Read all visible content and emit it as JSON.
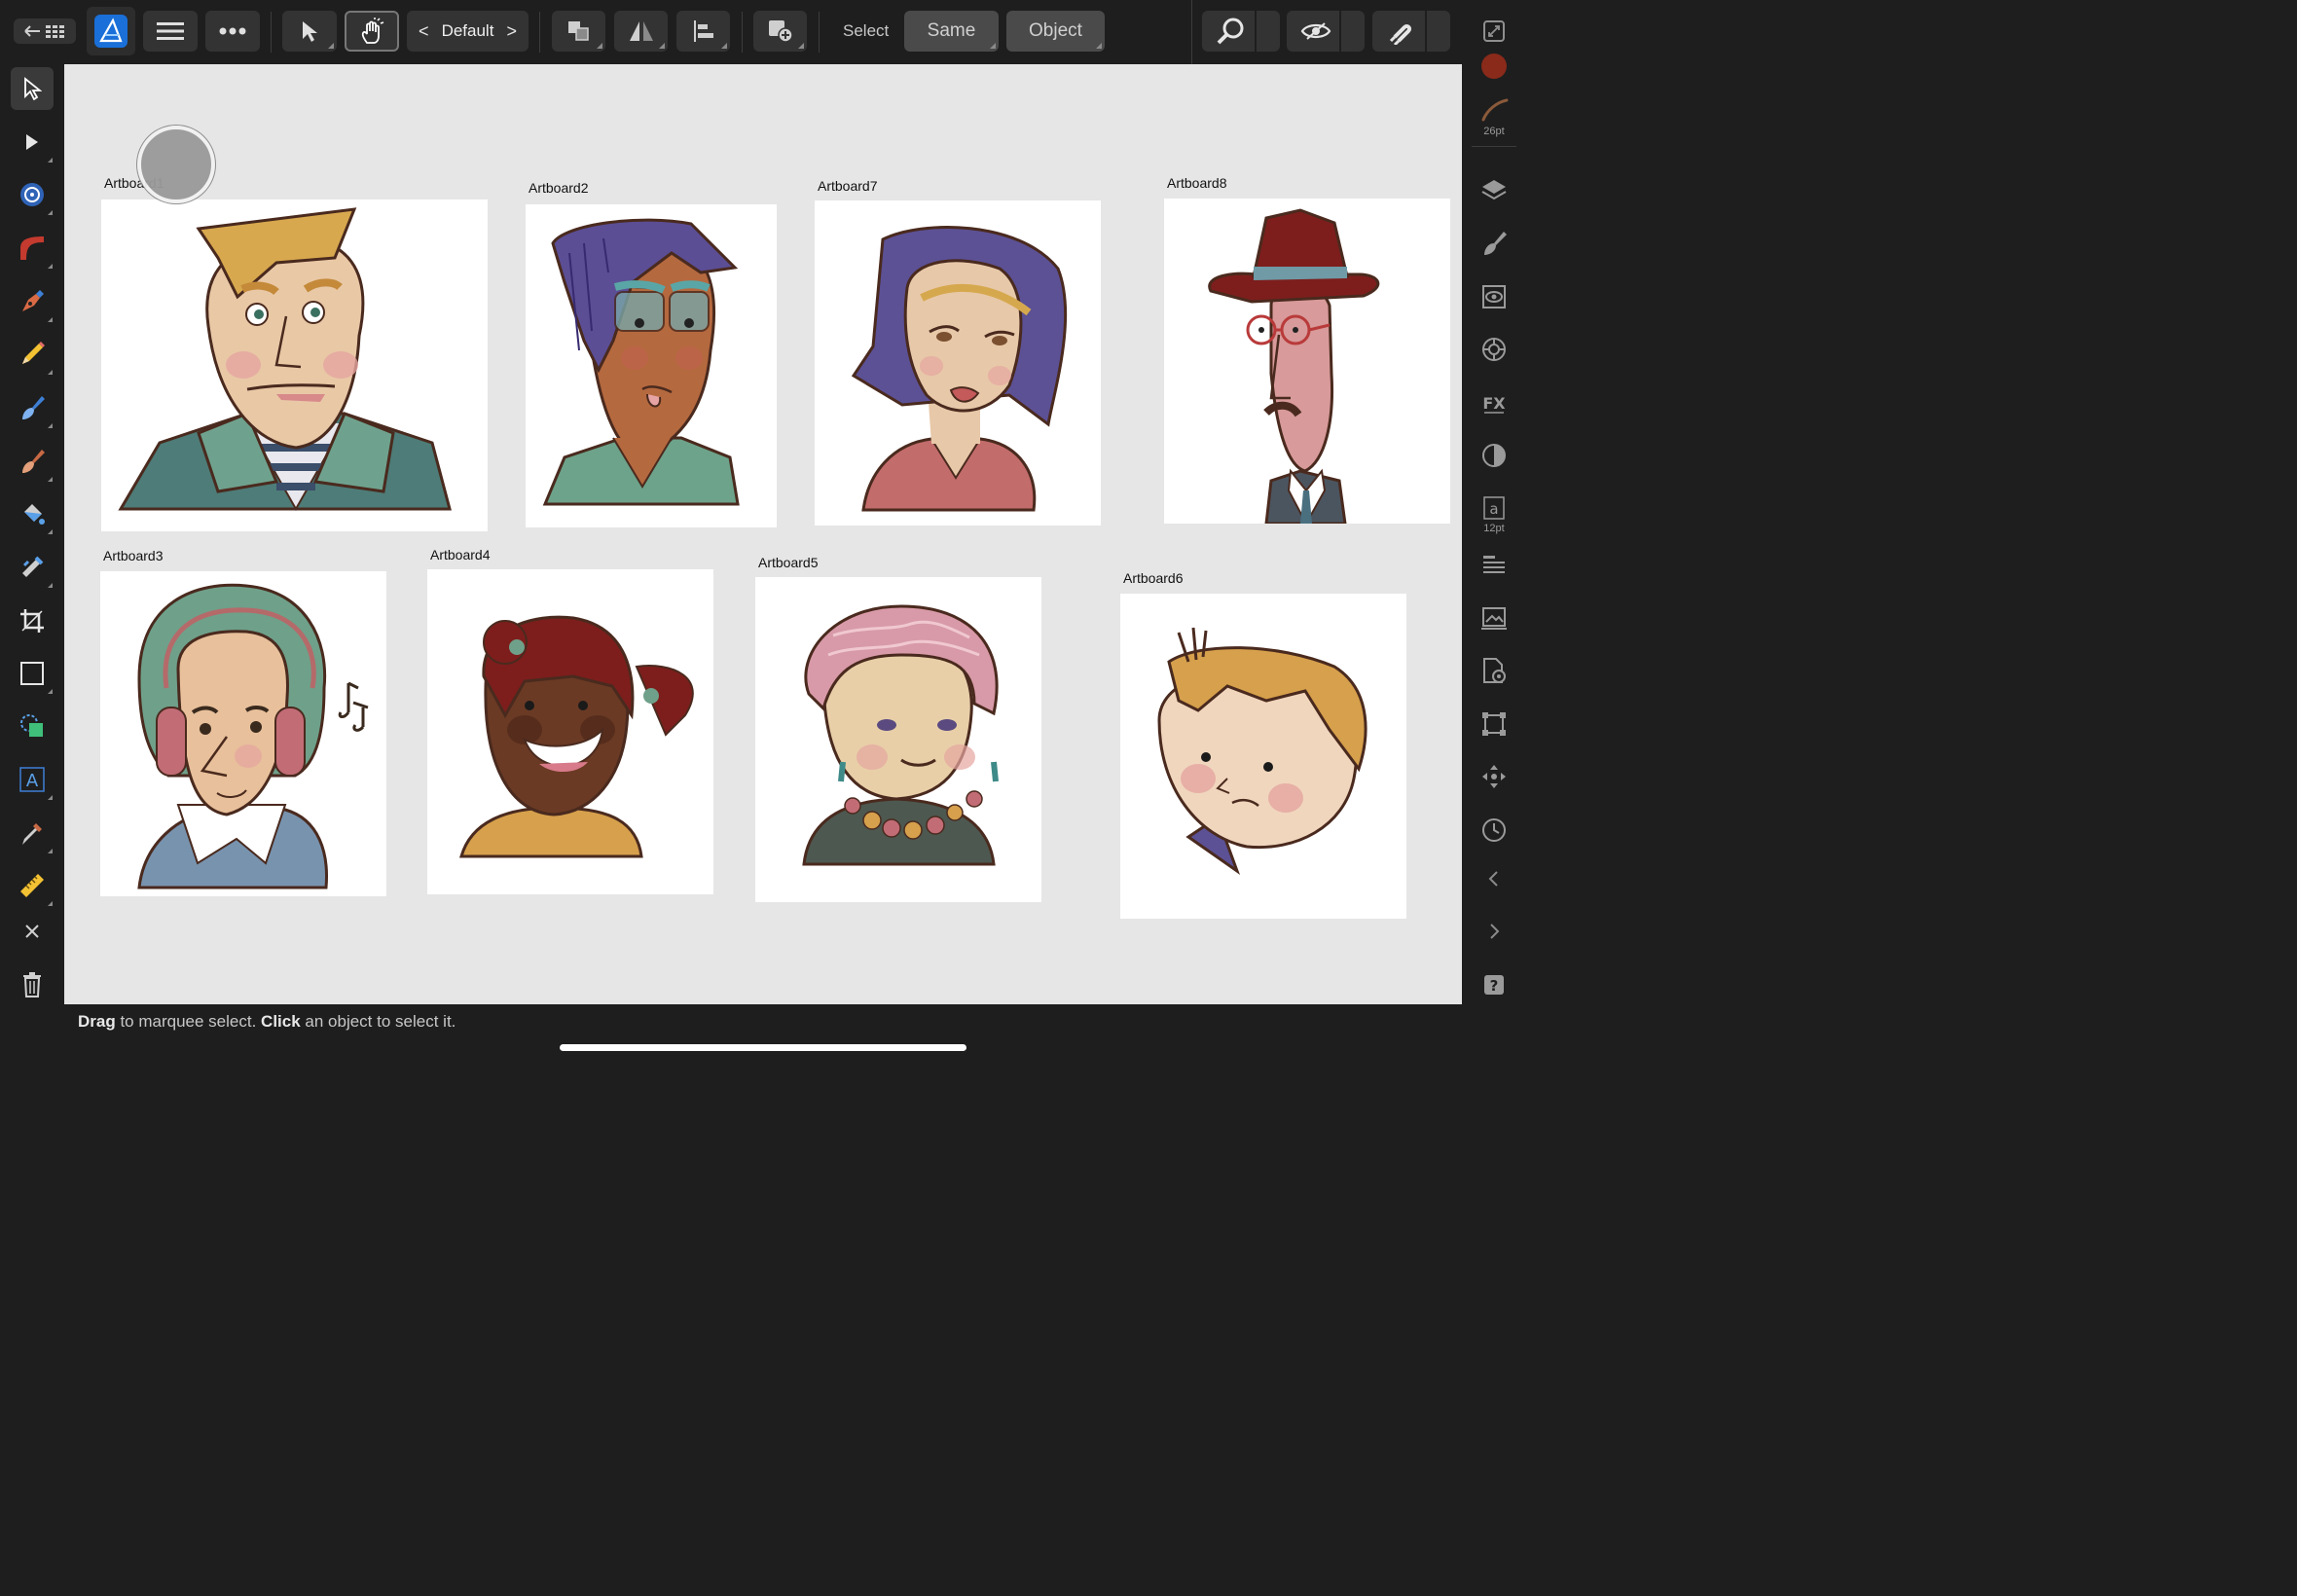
{
  "toolbar": {
    "back_icon": "back-arrow-grid-icon",
    "persona_icon": "designer-persona-icon",
    "menu_icon": "hamburger-icon",
    "more_icon": "more-icon",
    "move_tool_icon": "move-pointer-icon",
    "hand_tool_icon": "hand-touch-icon",
    "workspace_prev": "<",
    "workspace_label": "Default",
    "workspace_next": ">",
    "arrange_icon": "arrange-icon",
    "flip_icon": "flip-icon",
    "align_icon": "align-icon",
    "insert_icon": "insert-object-icon",
    "select_label": "Select",
    "same_label": "Same",
    "object_label": "Object",
    "zoom_icon": "zoom-icon",
    "view_icon": "view-mode-icon",
    "snapping_icon": "snapping-magnet-icon",
    "fullscreen_icon": "fullscreen-icon"
  },
  "left_tools": [
    {
      "name": "move-tool",
      "icon": "pointer-icon"
    },
    {
      "name": "node-tool",
      "icon": "node-pointer-icon"
    },
    {
      "name": "corner-tool",
      "icon": "corner-tool-icon"
    },
    {
      "name": "gradient-tool",
      "icon": "gradient-tool-icon"
    },
    {
      "name": "pen-tool",
      "icon": "pen-icon"
    },
    {
      "name": "pencil-tool",
      "icon": "pencil-icon"
    },
    {
      "name": "vector-brush-tool",
      "icon": "brush-icon"
    },
    {
      "name": "pixel-brush-tool",
      "icon": "pixel-brush-icon"
    },
    {
      "name": "fill-tool",
      "icon": "fill-bucket-icon"
    },
    {
      "name": "transparency-tool",
      "icon": "transparency-icon"
    },
    {
      "name": "crop-tool",
      "icon": "crop-icon"
    },
    {
      "name": "rectangle-tool",
      "icon": "rectangle-icon"
    },
    {
      "name": "shape-builder-tool",
      "icon": "shape-builder-icon"
    },
    {
      "name": "artistic-text-tool",
      "icon": "text-icon"
    },
    {
      "name": "color-picker-tool",
      "icon": "eyedropper-icon"
    },
    {
      "name": "measure-tool",
      "icon": "ruler-icon"
    },
    {
      "name": "close-tool",
      "icon": "close-icon"
    },
    {
      "name": "delete-tool",
      "icon": "trash-icon"
    }
  ],
  "right_panel": {
    "brush_size": "26pt",
    "text_size": "12pt",
    "items": [
      "color-swatch-icon",
      "brush-stroke-icon",
      "layers-icon",
      "brushes-icon",
      "appearance-icon",
      "adjustments-icon",
      "effects-icon",
      "styles-icon",
      "character-icon",
      "paragraph-icon",
      "stock-icon",
      "document-icon",
      "transform-icon",
      "navigator-icon",
      "history-icon",
      "collapse-left-icon",
      "expand-right-icon",
      "help-icon"
    ]
  },
  "artboards": [
    {
      "id": "ab1",
      "label": "Artboard1"
    },
    {
      "id": "ab2",
      "label": "Artboard2"
    },
    {
      "id": "ab7",
      "label": "Artboard7"
    },
    {
      "id": "ab8",
      "label": "Artboard8"
    },
    {
      "id": "ab3",
      "label": "Artboard3"
    },
    {
      "id": "ab4",
      "label": "Artboard4"
    },
    {
      "id": "ab5",
      "label": "Artboard5"
    },
    {
      "id": "ab6",
      "label": "Artboard6"
    }
  ],
  "status": {
    "drag": "Drag",
    "drag_text": " to marquee select. ",
    "click": "Click",
    "click_text": " an object to select it."
  }
}
